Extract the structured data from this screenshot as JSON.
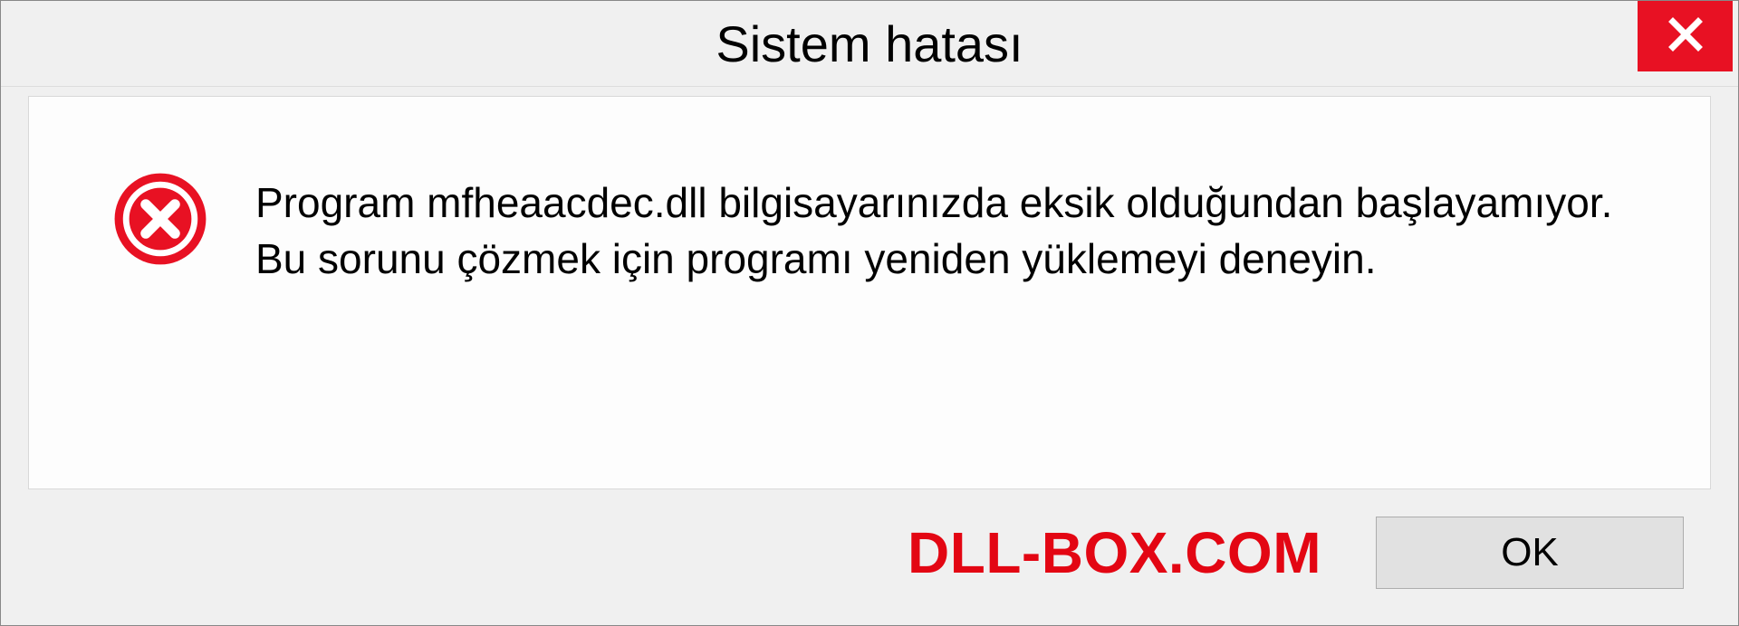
{
  "titlebar": {
    "title": "Sistem hatası"
  },
  "content": {
    "message": "Program mfheaacdec.dll bilgisayarınızda eksik olduğundan başlayamıyor. Bu sorunu çözmek için programı yeniden yüklemeyi deneyin."
  },
  "footer": {
    "watermark": "DLL-BOX.COM",
    "ok_label": "OK"
  }
}
